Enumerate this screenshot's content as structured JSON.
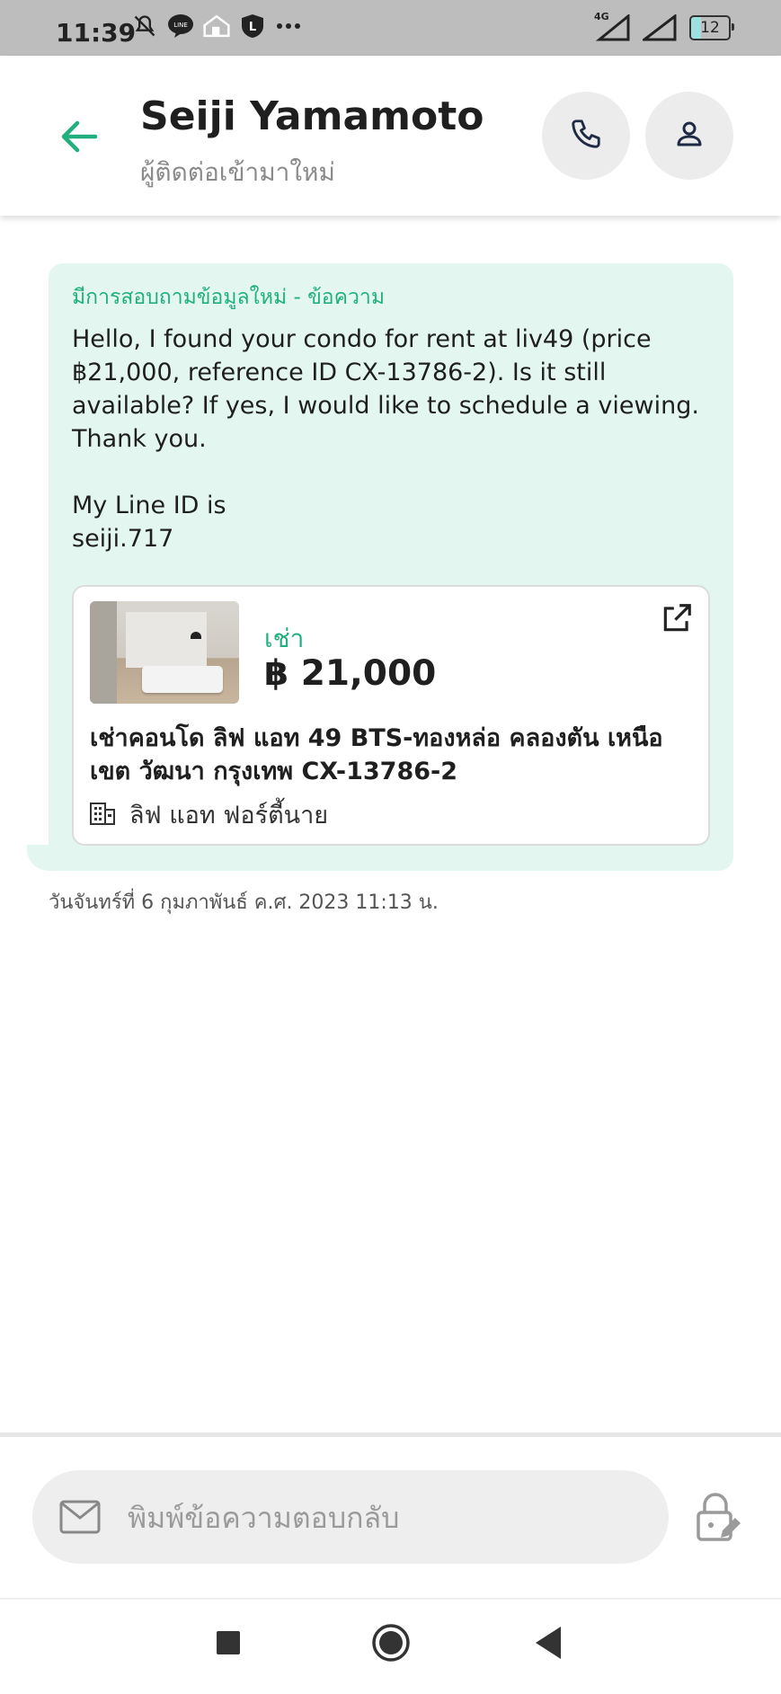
{
  "status_bar": {
    "time": "11:39",
    "network": "4G",
    "battery": "12"
  },
  "header": {
    "name": "Seiji Yamamoto",
    "subtitle": "ผู้ติดต่อเข้ามาใหม่"
  },
  "message": {
    "header": "มีการสอบถามข้อมูลใหม่ - ข้อความ",
    "body": "Hello, I found your condo for rent at liv49 (price ฿21,000, reference ID CX-13786-2). Is it still available? If yes, I would like to schedule a viewing. Thank you.\n\nMy Line ID is\nseiji.717",
    "timestamp": "วันจันทร์ที่ 6 กุมภาพันธ์ ค.ศ. 2023 11:13 น."
  },
  "listing": {
    "type": "เช่า",
    "price": "฿ 21,000",
    "title": "เช่าคอนโด  ลิฟ แอท 49 BTS-ทองหล่อ คลองตัน เหนือ เขต วัฒนา กรุงเทพ CX-13786-2",
    "project": "ลิฟ แอท ฟอร์ตี้นาย"
  },
  "composer": {
    "placeholder": "พิมพ์ข้อความตอบกลับ"
  },
  "colors": {
    "accent": "#21b07d",
    "bubble": "#e3f7f0"
  }
}
